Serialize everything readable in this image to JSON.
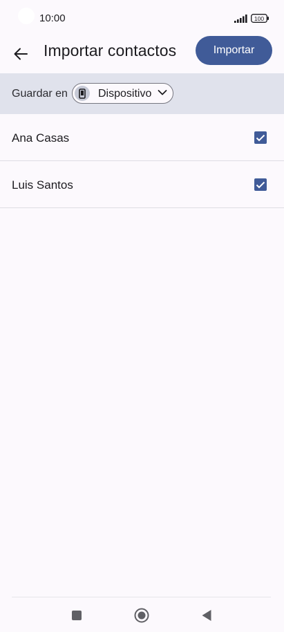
{
  "status_bar": {
    "time": "10:00",
    "battery": "100"
  },
  "app_bar": {
    "back_icon": "arrow-left-icon",
    "title": "Importar contactos",
    "import_label": "Importar"
  },
  "save_bar": {
    "label": "Guardar en",
    "chip_label": "Dispositivo",
    "chip_icon": "phone-icon",
    "chevron_icon": "chevron-down-icon"
  },
  "contacts": [
    {
      "name": "Ana Casas",
      "checked": true
    },
    {
      "name": "Luis Santos",
      "checked": true
    }
  ],
  "nav_bar": {
    "recents_icon": "square-icon",
    "home_icon": "circle-icon",
    "back_icon": "triangle-back-icon"
  },
  "colors": {
    "accent": "#405b98",
    "background": "#fcf9fd",
    "save_bar_bg": "#e0e2ec"
  }
}
